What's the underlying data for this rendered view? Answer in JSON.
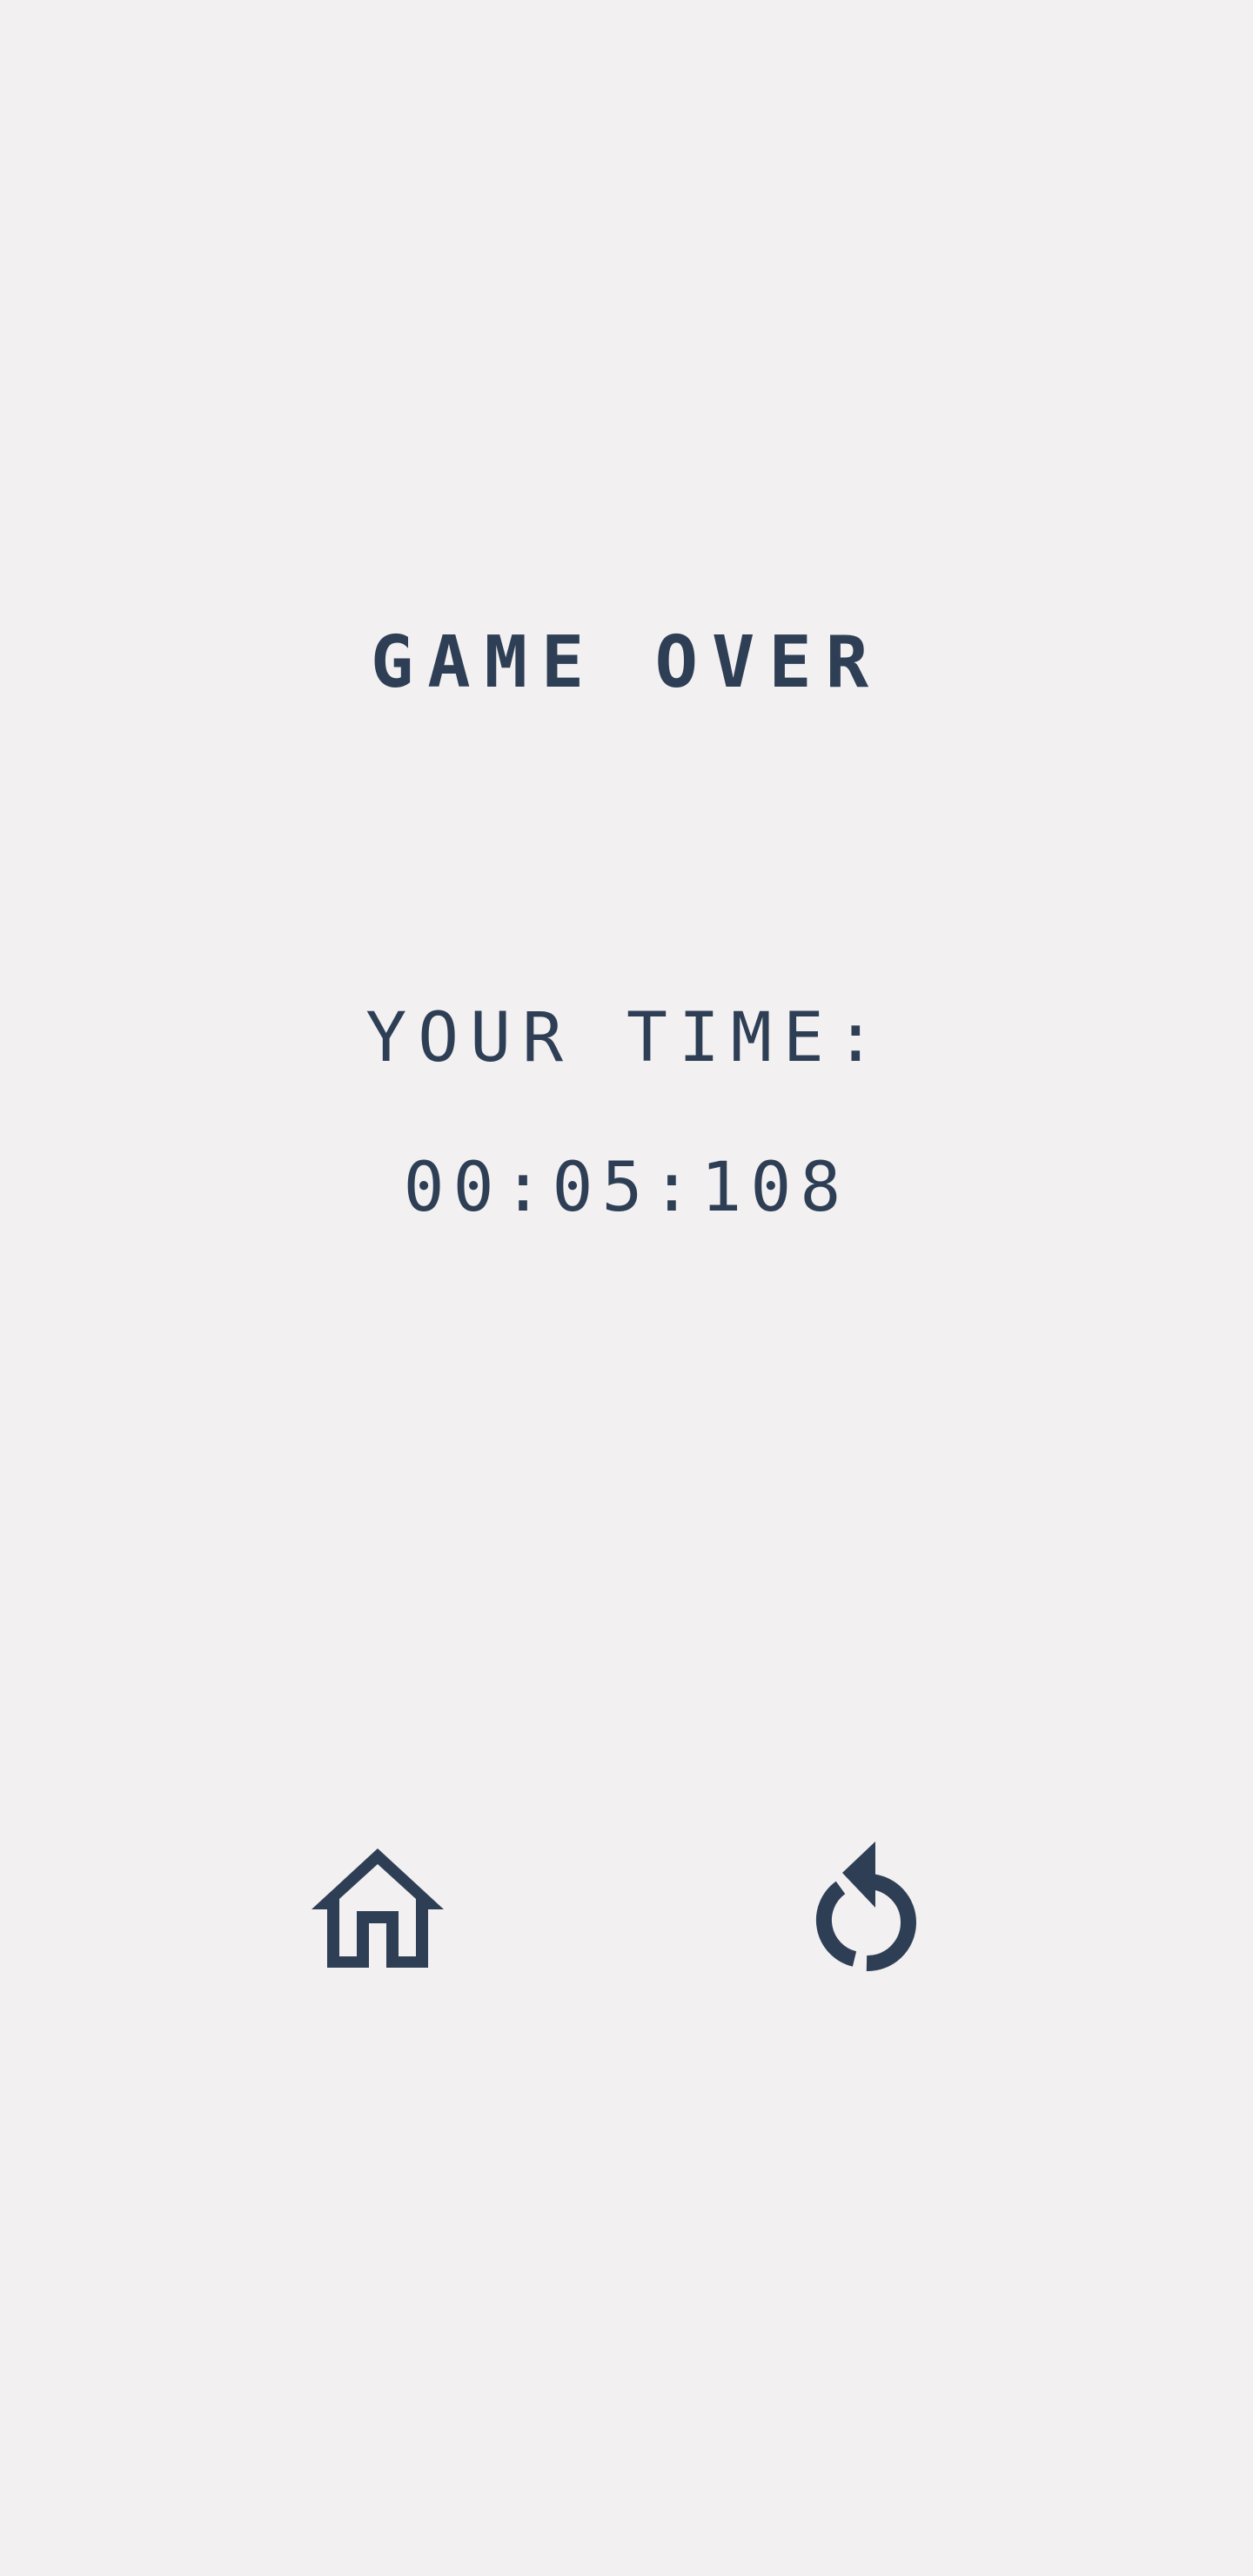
{
  "game_over": {
    "title": "GAME OVER",
    "time_label": "YOUR TIME:",
    "time_value": "00:05:108"
  },
  "controls": {
    "home_icon": "home-icon",
    "restart_icon": "restart-icon"
  },
  "colors": {
    "background": "#f2f0f1",
    "foreground": "#2e3f55"
  }
}
